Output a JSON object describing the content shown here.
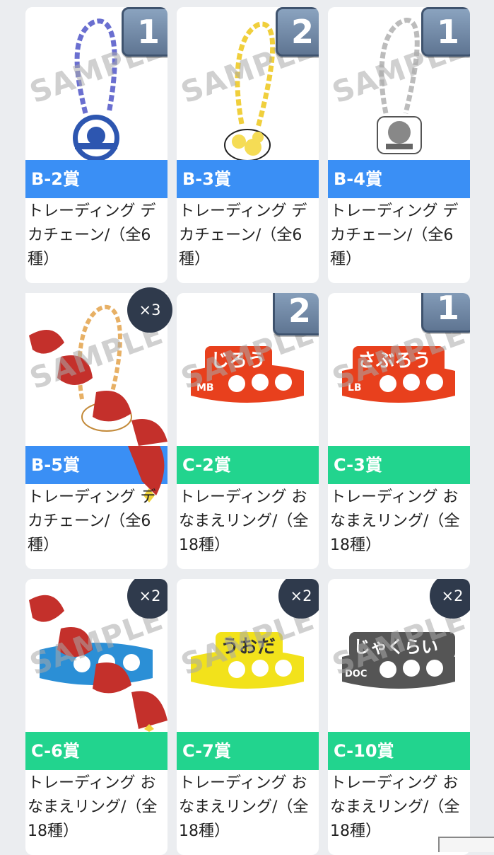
{
  "sample_text": "SAMPLE",
  "colors": {
    "blue": "#3a8ff5",
    "green": "#22d48e",
    "badge": "#5f7592",
    "dark_badge": "#2f3a4c"
  },
  "cards": [
    {
      "label": "B-2賞",
      "desc": "トレーディング デカチェーン/（全6種）",
      "badge": "1",
      "badge_type": "number",
      "label_color": "blue",
      "art": "chain-keychain-skull-icon"
    },
    {
      "label": "B-3賞",
      "desc": "トレーディング デカチェーン/（全6種）",
      "badge": "2",
      "badge_type": "number",
      "label_color": "blue",
      "art": "chain-keychain-yellow-icon"
    },
    {
      "label": "B-4賞",
      "desc": "トレーディング デカチェーン/（全6種）",
      "badge": "1",
      "badge_type": "number",
      "label_color": "blue",
      "art": "chain-keychain-silver-icon"
    },
    {
      "label": "B-5賞",
      "desc": "トレーディング デカチェーン/（全6種）",
      "badge": "×3",
      "badge_type": "count",
      "label_color": "blue",
      "art": "chain-keychain-arigatou-icon"
    },
    {
      "label": "C-2賞",
      "desc": "トレーディング おなまえリング/（全18種）",
      "badge": "2",
      "badge_type": "number",
      "label_color": "green",
      "art": "name-ring-orange-icon",
      "ring_text": "じろう",
      "ring_tag": "MB"
    },
    {
      "label": "C-3賞",
      "desc": "トレーディング おなまえリング/（全18種）",
      "badge": "1",
      "badge_type": "number",
      "label_color": "green",
      "art": "name-ring-orange-icon",
      "ring_text": "さぶろう",
      "ring_tag": "LB"
    },
    {
      "label": "C-6賞",
      "desc": "トレーディング おなまえリング/（全18種）",
      "badge": "×2",
      "badge_type": "count",
      "label_color": "green",
      "art": "name-ring-blue-arigatou-icon"
    },
    {
      "label": "C-7賞",
      "desc": "トレーディング おなまえリング/（全18種）",
      "badge": "×2",
      "badge_type": "count",
      "label_color": "green",
      "art": "name-ring-yellow-icon",
      "ring_text": "うおだ"
    },
    {
      "label": "C-10賞",
      "desc": "トレーディング おなまえリング/（全18種）",
      "badge": "×2",
      "badge_type": "count",
      "label_color": "green",
      "art": "name-ring-gray-icon",
      "ring_text": "じゃくらい",
      "ring_tag": "DOC"
    }
  ]
}
